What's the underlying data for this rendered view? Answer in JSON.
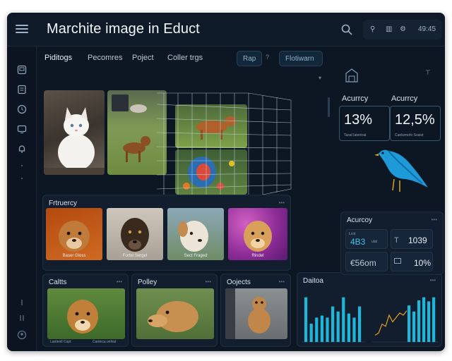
{
  "app": {
    "title": "Marchite image in Educt"
  },
  "header": {
    "tools": [
      "⚲",
      "▥",
      "⚙",
      "49:45"
    ]
  },
  "tabs": [
    {
      "label": "Piditogs",
      "active": true
    },
    {
      "label": "Pecomres",
      "active": false
    },
    {
      "label": "Poject",
      "active": false
    },
    {
      "label": "Coller trgs",
      "active": false
    }
  ],
  "tab_pills": {
    "small": "Rap",
    "sep": "?",
    "wide": "Flotiwarn"
  },
  "cards": {
    "frequency": {
      "title": "Frtruercy",
      "thumbs": [
        {
          "caption": "Baser Gloss"
        },
        {
          "caption": "Fortel Sergel"
        },
        {
          "caption": "Sect Fraged"
        },
        {
          "caption": "Rindel"
        }
      ]
    },
    "bottom": [
      {
        "title": "Caltts",
        "caption_left": "Lantenil Copt",
        "caption_right": "Canteca onhist"
      },
      {
        "title": "Polley",
        "caption_left": "",
        "caption_right": ""
      },
      {
        "title": "Oojects",
        "caption_left": "",
        "caption_right": ""
      }
    ],
    "dashboard": {
      "title": "Daitoa"
    }
  },
  "right": {
    "stats": [
      {
        "label": "Acurrcy",
        "value": "13%",
        "sub": "Tasal Iatentrat"
      },
      {
        "label": "Acurrcy",
        "value": "12,5%",
        "sub": "Caelwmohr Sosiet"
      }
    ],
    "accuracy_card": {
      "title": "Acurcoy",
      "metrics": [
        {
          "prefix": "Lcot",
          "value": "4B3",
          "suffix": "ulat"
        },
        {
          "prefix": "T",
          "value": "1039",
          "suffix": ""
        },
        {
          "prefix": "",
          "value": "€56om",
          "suffix": ""
        },
        {
          "prefix": "",
          "value": "10%",
          "suffix": ""
        }
      ]
    }
  },
  "chart_data": {
    "type": "bar",
    "title": "Daitoa",
    "series": [
      {
        "values": [
          44,
          18,
          24,
          26,
          24,
          35,
          30,
          44,
          28,
          24,
          35
        ]
      },
      {
        "values": [
          36,
          30,
          41,
          44,
          40,
          44
        ]
      }
    ],
    "line": [
      3,
      4,
      8,
      7,
      12,
      9,
      11,
      13,
      12,
      14
    ],
    "colors": {
      "bar": "#1fb6d9",
      "line": "#e0a020"
    }
  }
}
